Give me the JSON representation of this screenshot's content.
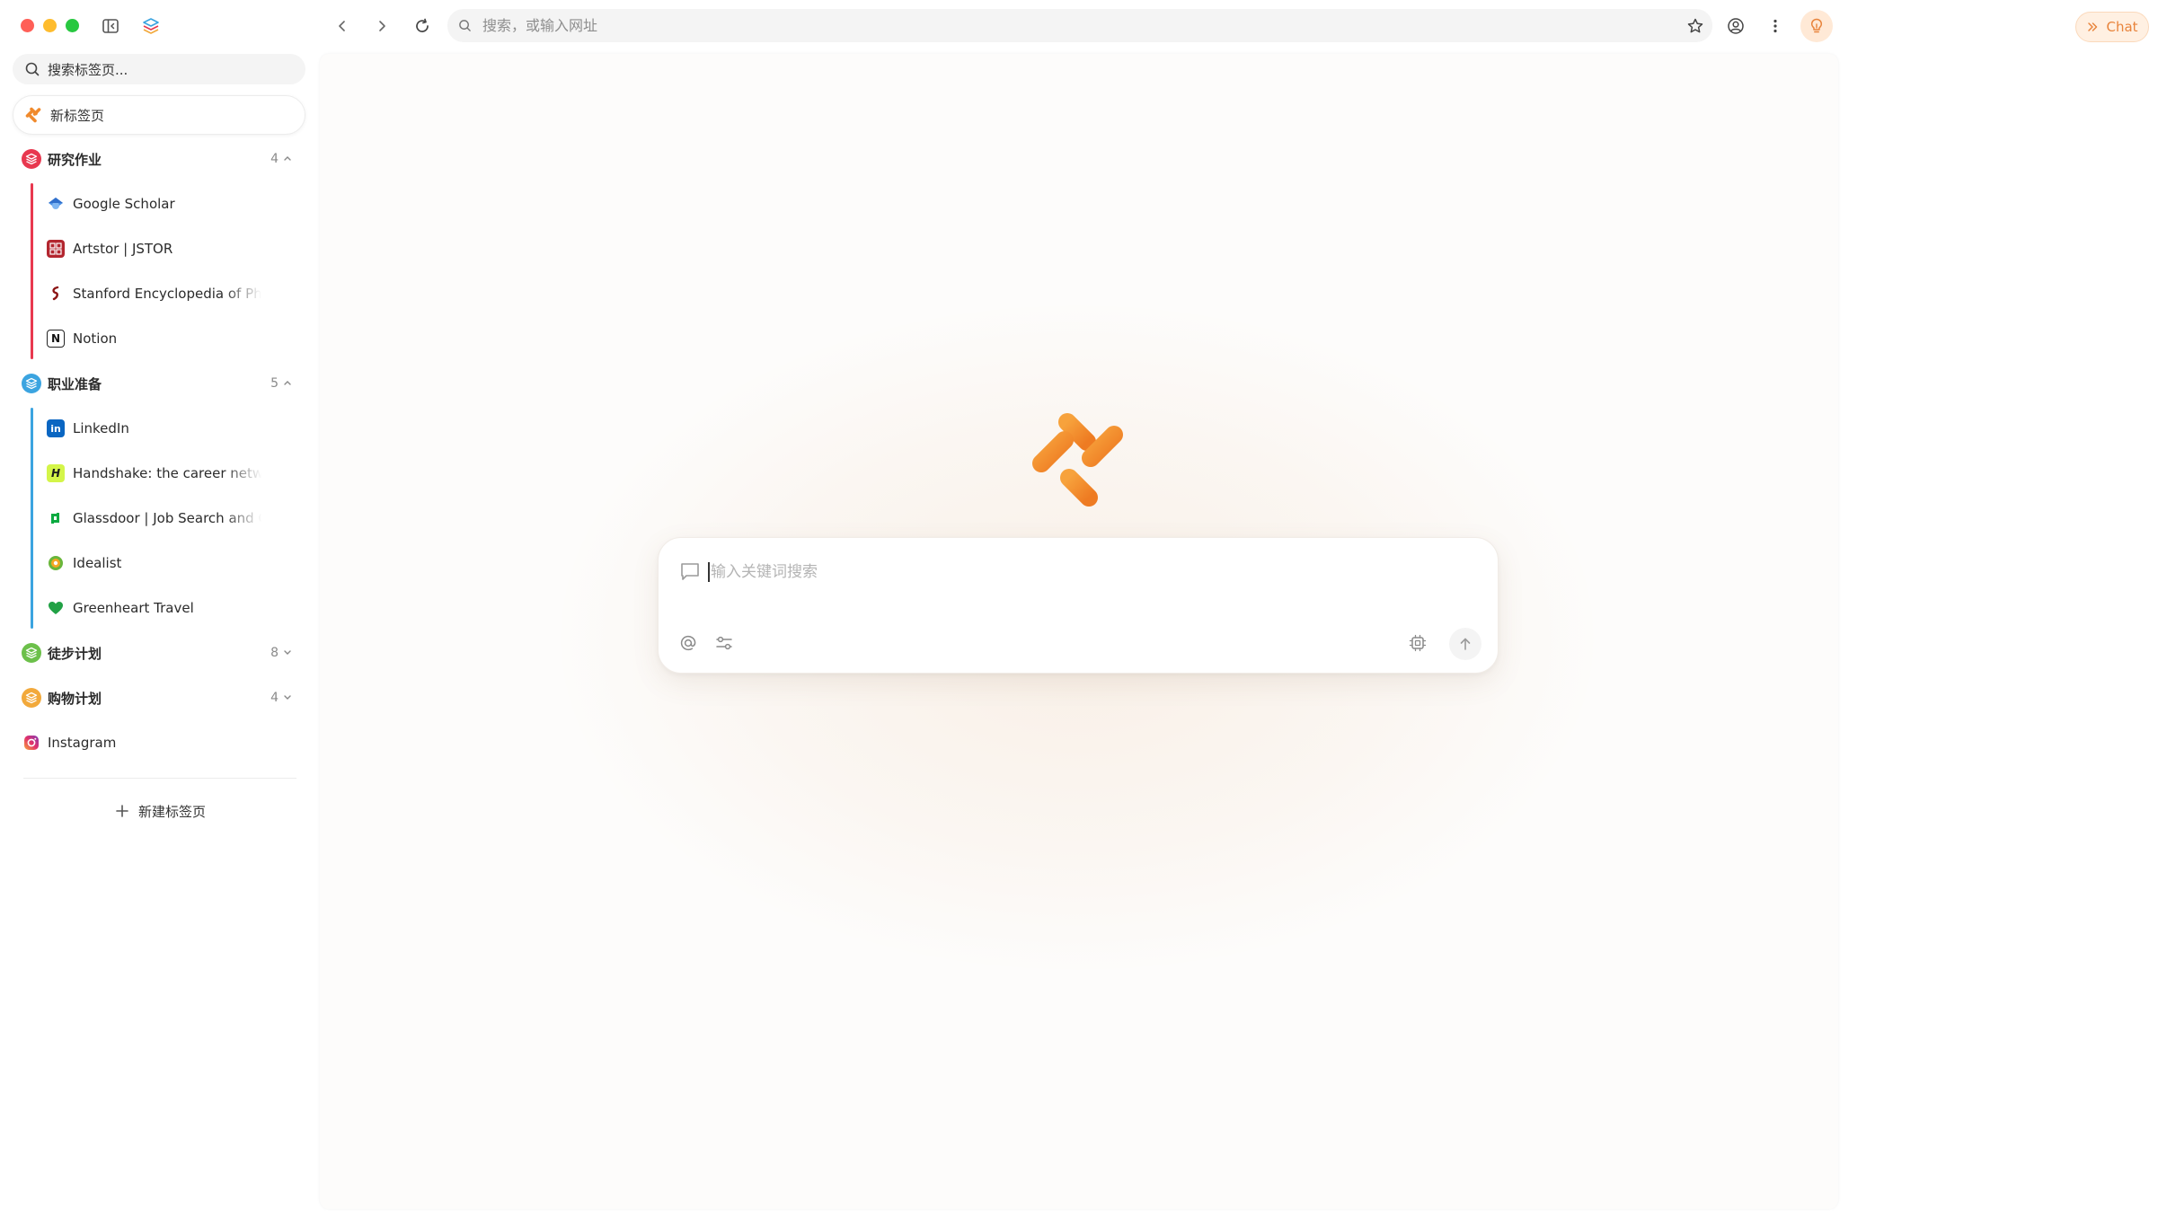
{
  "sidebar": {
    "search_placeholder": "搜索标签页...",
    "new_tab_pill": "新标签页",
    "groups": [
      {
        "name": "研究作业",
        "count": "4",
        "color": "#e8384f",
        "expanded": true,
        "tabs": [
          {
            "title": "Google Scholar",
            "icon": "google-scholar-icon"
          },
          {
            "title": "Artstor | JSTOR",
            "icon": "jstor-icon"
          },
          {
            "title": "Stanford Encyclopedia of Philosophy",
            "icon": "stanford-icon"
          },
          {
            "title": "Notion",
            "icon": "notion-icon"
          }
        ]
      },
      {
        "name": "职业准备",
        "count": "5",
        "color": "#3ba4e0",
        "expanded": true,
        "tabs": [
          {
            "title": "LinkedIn",
            "icon": "linkedin-icon"
          },
          {
            "title": "Handshake: the career network",
            "icon": "handshake-icon"
          },
          {
            "title": "Glassdoor | Job Search and Career",
            "icon": "glassdoor-icon"
          },
          {
            "title": "Idealist",
            "icon": "idealist-icon"
          },
          {
            "title": "Greenheart Travel",
            "icon": "heart-icon"
          }
        ]
      },
      {
        "name": "徒步计划",
        "count": "8",
        "color": "#6cc04a",
        "expanded": false
      },
      {
        "name": "购物计划",
        "count": "4",
        "color": "#f2a93b",
        "expanded": false
      }
    ],
    "loose_tab": {
      "title": "Instagram",
      "icon": "instagram-icon"
    },
    "new_tab_button": "新建标签页"
  },
  "toolbar": {
    "address_placeholder": "搜索，或输入网址",
    "chat_label": "Chat",
    "accent": "#e8843c"
  },
  "main": {
    "search_placeholder": "输入关键词搜索"
  }
}
